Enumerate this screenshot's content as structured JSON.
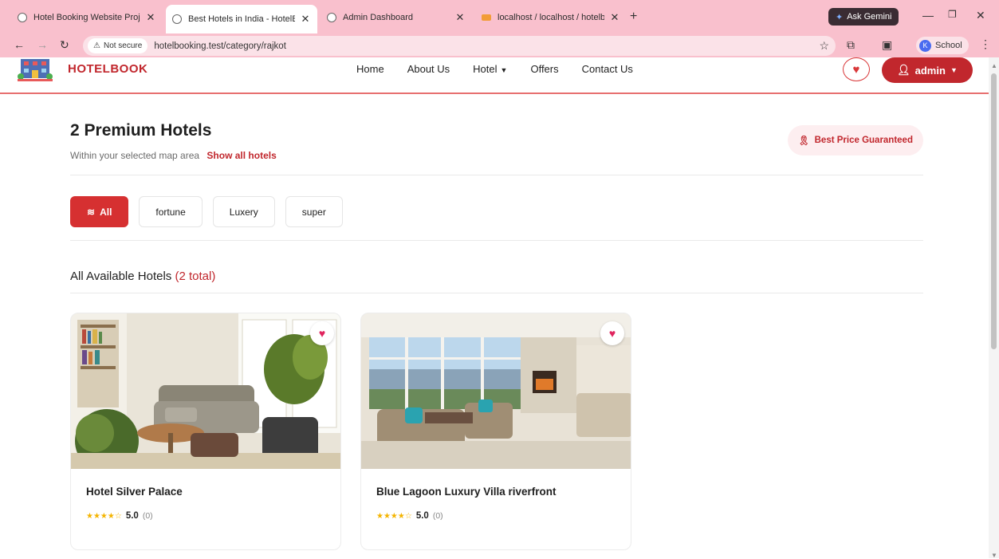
{
  "browser": {
    "tabs": [
      {
        "title": "Hotel Booking Website Project",
        "active": false
      },
      {
        "title": "Best Hotels in India - HotelBook",
        "active": true
      },
      {
        "title": "Admin Dashboard",
        "active": false
      },
      {
        "title": "localhost / localhost / hotelbook",
        "active": false
      }
    ],
    "gemini_label": "Ask Gemini",
    "not_secure_label": "Not secure",
    "url": "hotelbooking.test/category/rajkot",
    "profile_label": "School",
    "profile_initial": "K"
  },
  "header": {
    "logo_text": "HOTELBOOK",
    "nav": {
      "home": "Home",
      "about": "About Us",
      "hotel": "Hotel",
      "offers": "Offers",
      "contact": "Contact Us"
    },
    "admin_label": "admin"
  },
  "main": {
    "title": "2 Premium Hotels",
    "subtitle": "Within your selected map area",
    "show_all_link": "Show all hotels",
    "best_price_label": "Best Price Guaranteed",
    "filters": {
      "all": "All",
      "fortune": "fortune",
      "luxery": "Luxery",
      "super": "super"
    },
    "section_title": "All Available Hotels",
    "section_count": "(2 total)",
    "hotels": [
      {
        "name": "Hotel Silver Palace",
        "stars": "★★★★☆",
        "score": "5.0",
        "reviews": "(0)"
      },
      {
        "name": "Blue Lagoon Luxury Villa riverfront",
        "stars": "★★★★☆",
        "score": "5.0",
        "reviews": "(0)"
      }
    ]
  },
  "colors": {
    "brand_red": "#c1272d",
    "chrome_pink": "#f9c0cd",
    "star_gold": "#f4b400"
  }
}
